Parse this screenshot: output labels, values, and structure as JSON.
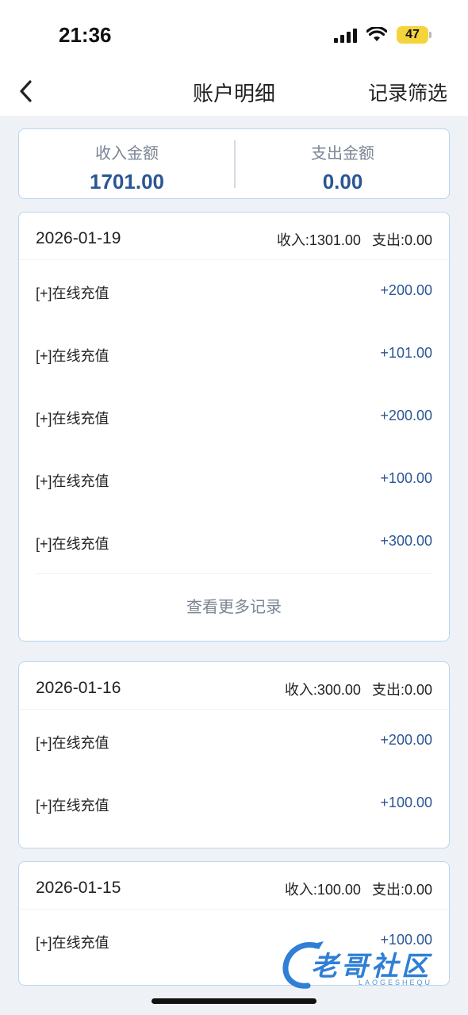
{
  "status_bar": {
    "time": "21:36",
    "battery": "47"
  },
  "nav": {
    "title": "账户明细",
    "filter_label": "记录筛选"
  },
  "summary": {
    "income_label": "收入金额",
    "income_value": "1701.00",
    "expense_label": "支出金额",
    "expense_value": "0.00"
  },
  "days": [
    {
      "date": "2026-01-19",
      "income": "收入:1301.00",
      "expense": "支出:0.00",
      "records": [
        {
          "label": "[+]在线充值",
          "amount": "+200.00"
        },
        {
          "label": "[+]在线充值",
          "amount": "+101.00"
        },
        {
          "label": "[+]在线充值",
          "amount": "+200.00"
        },
        {
          "label": "[+]在线充值",
          "amount": "+100.00"
        },
        {
          "label": "[+]在线充值",
          "amount": "+300.00"
        }
      ],
      "more_label": "查看更多记录"
    },
    {
      "date": "2026-01-16",
      "income": "收入:300.00",
      "expense": "支出:0.00",
      "records": [
        {
          "label": "[+]在线充值",
          "amount": "+200.00"
        },
        {
          "label": "[+]在线充值",
          "amount": "+100.00"
        }
      ]
    },
    {
      "date": "2026-01-15",
      "income": "收入:100.00",
      "expense": "支出:0.00",
      "records": [
        {
          "label": "[+]在线充值",
          "amount": "+100.00"
        }
      ]
    }
  ],
  "watermark": {
    "text": "老哥社区",
    "sub": "LAOGESHEQU"
  },
  "colors": {
    "accent": "#2b5694",
    "card_border": "#b8d6f0",
    "background": "#eef1f5",
    "muted": "#7b8594"
  },
  "icons": [
    "back-chevron-icon",
    "signal-icon",
    "wifi-icon",
    "battery-icon",
    "dragon-logo-icon"
  ]
}
